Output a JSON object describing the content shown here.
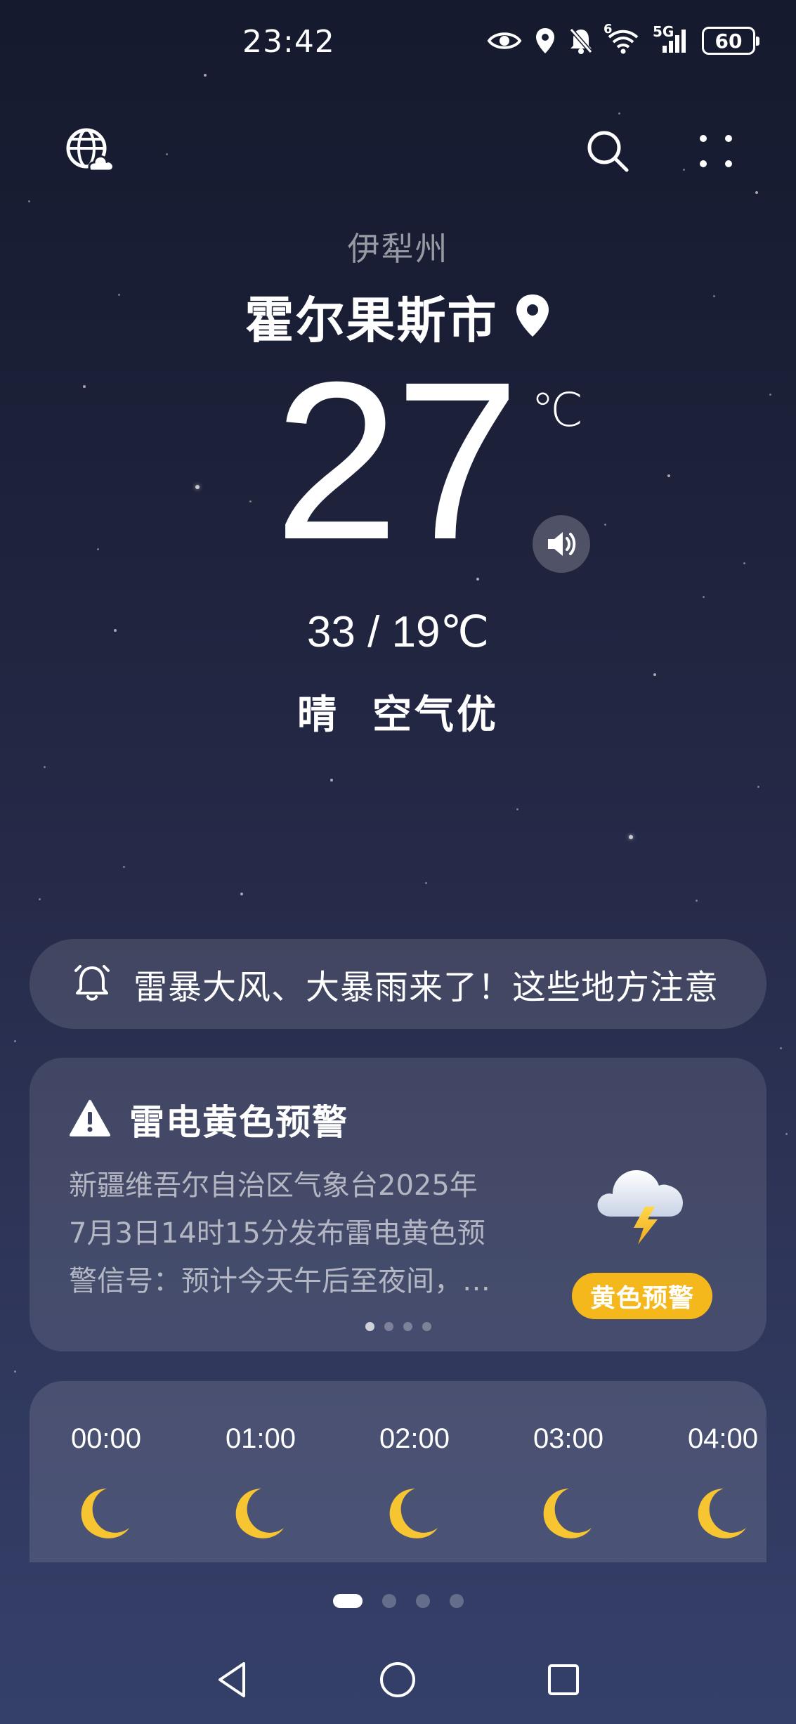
{
  "status_bar": {
    "time": "23:42",
    "icons": [
      "eye-icon",
      "location-icon",
      "mute-bell-icon",
      "wifi-6-icon",
      "5g-signal-icon"
    ],
    "network": "5G",
    "wifi_label": "6",
    "battery": "60"
  },
  "top_bar": {
    "left_icon": "globe-cloud-icon",
    "search_icon": "search-icon",
    "menu_icon": "four-dots-icon"
  },
  "location": {
    "province": "伊犁州",
    "city": "霍尔果斯市"
  },
  "current": {
    "temperature": "27",
    "unit": "℃",
    "range": "33 / 19℃",
    "condition": "晴  空气优"
  },
  "news": {
    "text": "雷暴大风、大暴雨来了！这些地方注意"
  },
  "warning": {
    "title": "雷电黄色预警",
    "body_lines": [
      "新疆维吾尔自治区气象台2025年",
      "7月3日14时15分发布雷电黄色预",
      "警信号：预计今天午后至夜间，…"
    ],
    "badge": "黄色预警",
    "badge_color": "#f5b81c",
    "pager_count": 4,
    "pager_active": 0
  },
  "hourly": [
    {
      "time": "00:00",
      "icon": "moon-icon"
    },
    {
      "time": "01:00",
      "icon": "moon-icon"
    },
    {
      "time": "02:00",
      "icon": "moon-icon"
    },
    {
      "time": "03:00",
      "icon": "moon-icon"
    },
    {
      "time": "04:00",
      "icon": "moon-icon"
    }
  ],
  "page_indicator": {
    "count": 4,
    "active": 0
  },
  "nav": [
    "back-icon",
    "home-icon",
    "recents-icon"
  ],
  "colors": {
    "moon": "#f7c531",
    "warning_badge": "#f5b81c",
    "background_top": "#161a2e",
    "background_bottom": "#35406a"
  }
}
